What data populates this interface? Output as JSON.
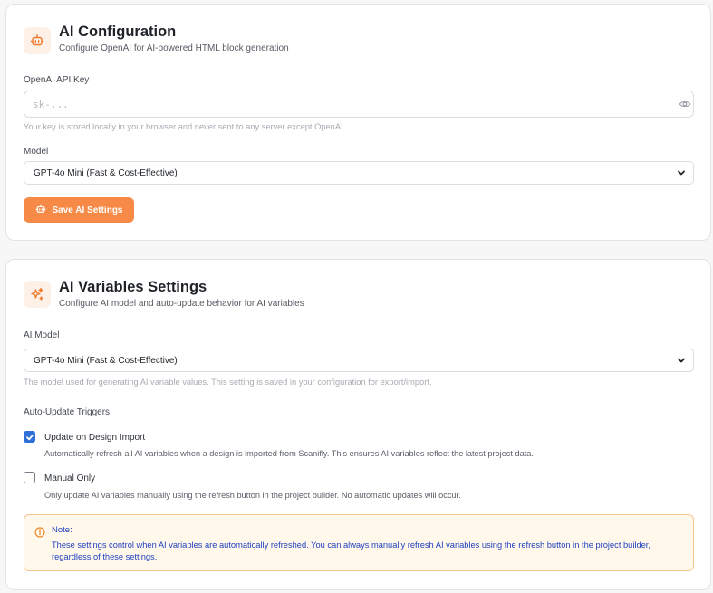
{
  "ai_config": {
    "title": "AI Configuration",
    "subtitle": "Configure OpenAI for AI-powered HTML block generation",
    "icon": "robot-icon",
    "api_key": {
      "label": "OpenAI API Key",
      "placeholder": "sk-...",
      "value": "",
      "hint": "Your key is stored locally in your browser and never sent to any server except OpenAI."
    },
    "model": {
      "label": "Model",
      "selected": "GPT-4o Mini (Fast & Cost-Effective)"
    },
    "save_button": "Save AI Settings"
  },
  "ai_variables": {
    "title": "AI Variables Settings",
    "subtitle": "Configure AI model and auto-update behavior for AI variables",
    "icon": "sparkles-icon",
    "model": {
      "label": "AI Model",
      "selected": "GPT-4o Mini (Fast & Cost-Effective)",
      "hint": "The model used for generating AI variable values. This setting is saved in your configuration for export/import."
    },
    "triggers": {
      "label": "Auto-Update Triggers",
      "options": [
        {
          "title": "Update on Design Import",
          "description": "Automatically refresh all AI variables when a design is imported from Scanifly. This ensures AI variables reflect the latest project data.",
          "checked": true
        },
        {
          "title": "Manual Only",
          "description": "Only update AI variables manually using the refresh button in the project builder. No automatic updates will occur.",
          "checked": false
        }
      ]
    },
    "note": {
      "title": "Note:",
      "body": "These settings control when AI variables are automatically refreshed. You can always manually refresh AI variables using the refresh button in the project builder, regardless of these settings."
    }
  },
  "colors": {
    "accent": "#f78a47",
    "checkbox": "#2f6fd6",
    "note_bg": "#fff8eb",
    "note_border": "#f5c68e",
    "note_text": "#1f3fbf"
  }
}
